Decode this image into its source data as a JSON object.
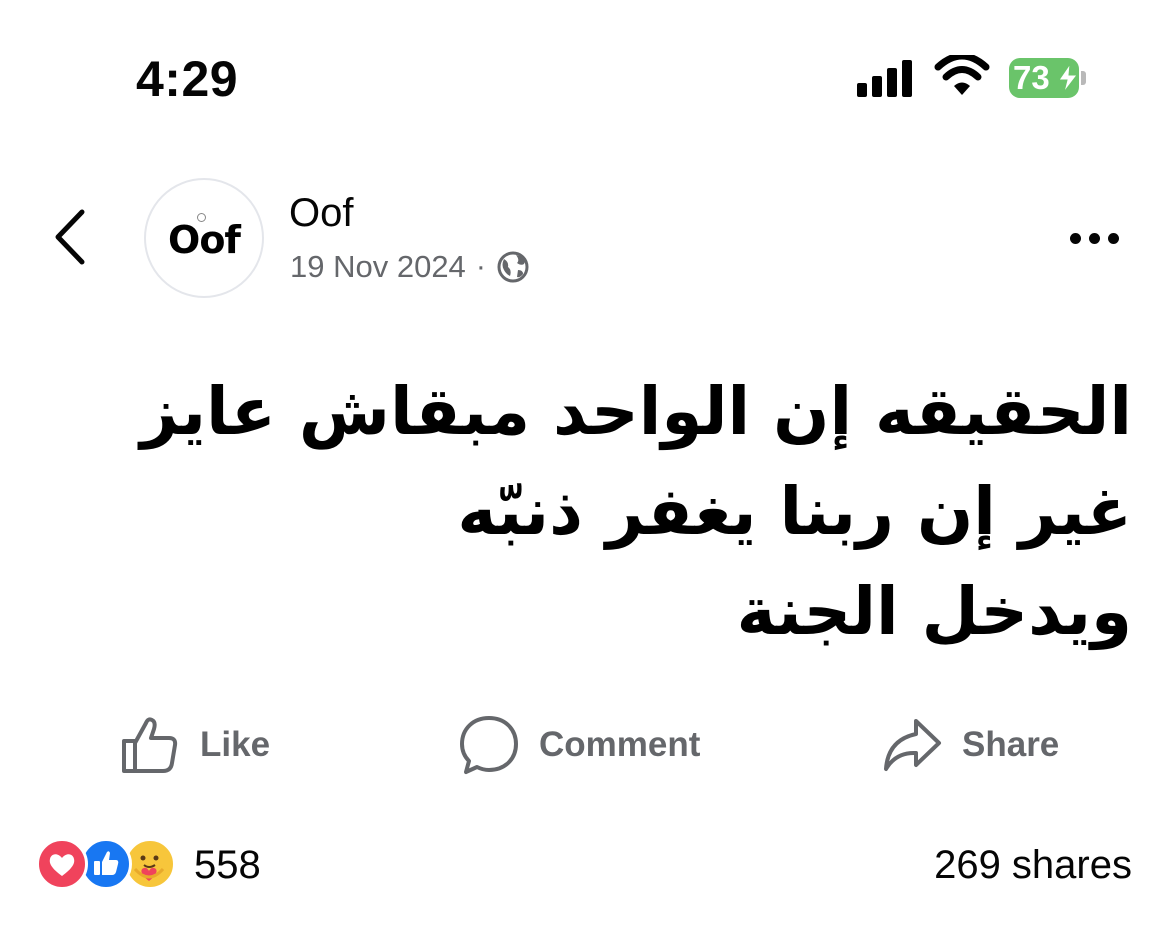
{
  "status_bar": {
    "time": "4:29",
    "battery": "73",
    "battery_color": "#6ac46a"
  },
  "post": {
    "author": "Oof",
    "avatar_text": "Oof",
    "date": "19 Nov 2024",
    "separator": "·",
    "audience_icon": "globe-icon",
    "text_lines": [
      "الحقيقه إن الواحد مبقاش عايز",
      "غير إن ربنا يغفر ذنبّه",
      "ويدخل الجنة"
    ]
  },
  "actions": {
    "like_label": "Like",
    "comment_label": "Comment",
    "share_label": "Share"
  },
  "footer": {
    "reaction_icons": [
      "heart-icon",
      "thumbs-up-icon",
      "care-icon"
    ],
    "reaction_count": "558",
    "shares": "269 shares"
  },
  "colors": {
    "secondary_text": "#65676b",
    "like_blue": "#1877f2",
    "heart_red": "#f0435c"
  }
}
